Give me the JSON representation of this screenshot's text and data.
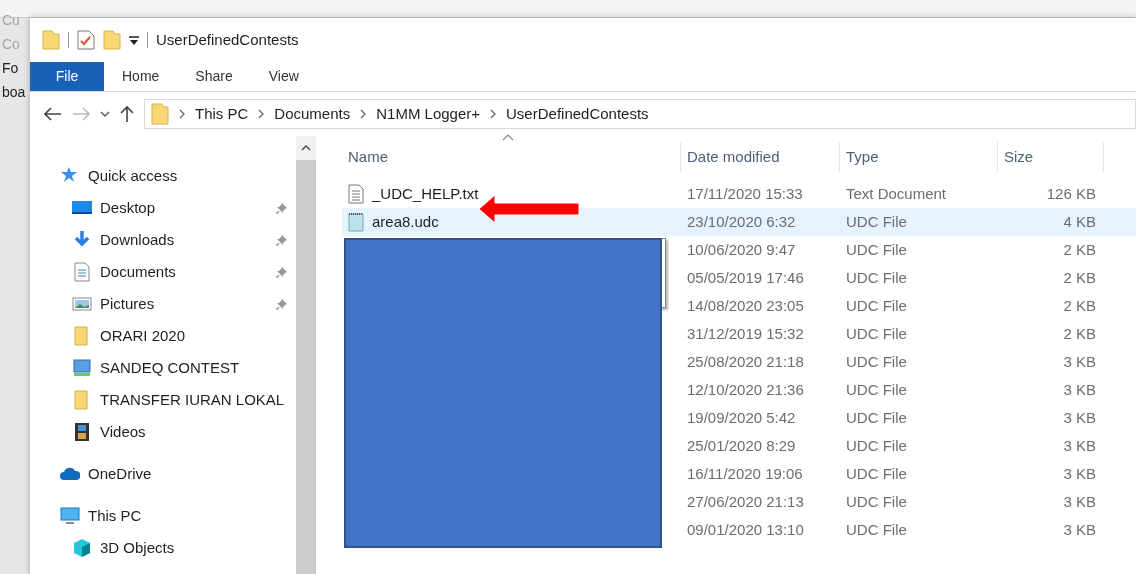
{
  "background_window": {
    "items": [
      {
        "label": "Cu",
        "disabled": true
      },
      {
        "label": "Co",
        "disabled": true
      },
      {
        "label": "Fo",
        "disabled": false
      },
      {
        "label": "boa",
        "disabled": false
      }
    ]
  },
  "window": {
    "title": "UserDefinedContests"
  },
  "ribbon_tabs": [
    {
      "label": "File",
      "selected": true
    },
    {
      "label": "Home",
      "selected": false
    },
    {
      "label": "Share",
      "selected": false
    },
    {
      "label": "View",
      "selected": false
    }
  ],
  "address_bar": {
    "path": [
      "This PC",
      "Documents",
      "N1MM Logger+",
      "UserDefinedContests"
    ]
  },
  "sidebar": {
    "items": [
      {
        "label": "Quick access",
        "kind": "star",
        "children": [
          {
            "label": "Desktop",
            "kind": "desktop",
            "pinned": true
          },
          {
            "label": "Downloads",
            "kind": "download",
            "pinned": true
          },
          {
            "label": "Documents",
            "kind": "documents",
            "pinned": true
          },
          {
            "label": "Pictures",
            "kind": "pictures",
            "pinned": true
          },
          {
            "label": "ORARI 2020",
            "kind": "folder",
            "pinned": false
          },
          {
            "label": "SANDEQ CONTEST",
            "kind": "drive",
            "pinned": false
          },
          {
            "label": "TRANSFER IURAN LOKAL",
            "kind": "folder",
            "pinned": false
          },
          {
            "label": "Videos",
            "kind": "videos",
            "pinned": false
          }
        ]
      },
      {
        "label": "OneDrive",
        "kind": "cloud"
      },
      {
        "label": "This PC",
        "kind": "pc",
        "children": [
          {
            "label": "3D Objects",
            "kind": "cube",
            "pinned": false
          }
        ]
      }
    ]
  },
  "table": {
    "columns": [
      "Name",
      "Date modified",
      "Type",
      "Size"
    ],
    "rows": [
      {
        "name": "_UDC_HELP.txt",
        "kind": "text",
        "date": "17/11/2020 15:33",
        "type": "Text Document",
        "size": "126 KB",
        "selected": false
      },
      {
        "name": "area8.udc",
        "kind": "udc",
        "date": "23/10/2020 6:32",
        "type": "UDC File",
        "size": "4 KB",
        "selected": true
      },
      {
        "kind": "udc",
        "date": "10/06/2020 9:47",
        "type": "UDC File",
        "size": "2 KB",
        "selected": false
      },
      {
        "kind": "udc",
        "date": "05/05/2019 17:46",
        "type": "UDC File",
        "size": "2 KB",
        "selected": false
      },
      {
        "kind": "udc",
        "date": "14/08/2020 23:05",
        "type": "UDC File",
        "size": "2 KB",
        "selected": false
      },
      {
        "kind": "udc",
        "date": "31/12/2019 15:32",
        "type": "UDC File",
        "size": "2 KB",
        "selected": false
      },
      {
        "kind": "udc",
        "date": "25/08/2020 21:18",
        "type": "UDC File",
        "size": "3 KB",
        "selected": false
      },
      {
        "kind": "udc",
        "date": "12/10/2020 21:36",
        "type": "UDC File",
        "size": "3 KB",
        "selected": false
      },
      {
        "kind": "udc",
        "date": "19/09/2020 5:42",
        "type": "UDC File",
        "size": "3 KB",
        "selected": false
      },
      {
        "kind": "udc",
        "date": "25/01/2020 8:29",
        "type": "UDC File",
        "size": "3 KB",
        "selected": false
      },
      {
        "kind": "udc",
        "date": "16/11/2020 19:06",
        "type": "UDC File",
        "size": "3 KB",
        "selected": false
      },
      {
        "kind": "udc",
        "date": "27/06/2020 21:13",
        "type": "UDC File",
        "size": "3 KB",
        "selected": false
      },
      {
        "kind": "udc",
        "date": "09/01/2020 13:10",
        "type": "UDC File",
        "size": "3 KB",
        "selected": false
      }
    ]
  }
}
